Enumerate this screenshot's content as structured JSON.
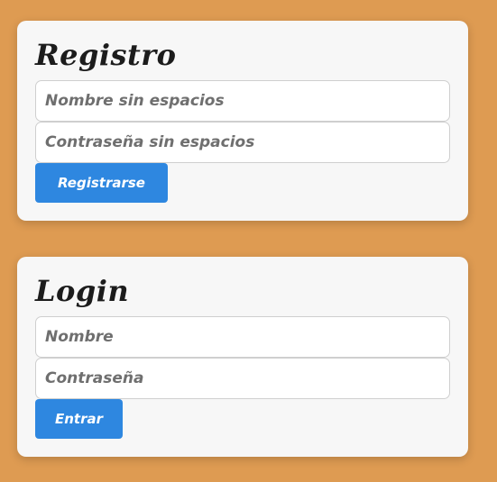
{
  "registro": {
    "title": "Registro",
    "username_placeholder": "Nombre sin espacios",
    "password_placeholder": "Contraseña sin espacios",
    "submit_label": "Registrarse"
  },
  "login": {
    "title": "Login",
    "username_placeholder": "Nombre",
    "password_placeholder": "Contraseña",
    "submit_label": "Entrar"
  },
  "colors": {
    "background": "#DE9B52",
    "card": "#F7F7F7",
    "button": "#2E87E0"
  }
}
